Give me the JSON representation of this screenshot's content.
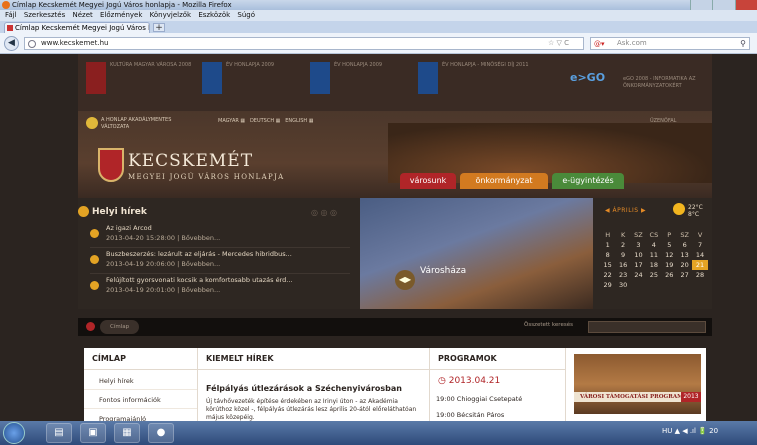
{
  "browser": {
    "window_title": "Címlap Kecskemét Megyei Jogú Város honlapja - Mozilla Firefox",
    "menu": [
      "Fájl",
      "Szerkesztés",
      "Nézet",
      "Előzmények",
      "Könyvjelzők",
      "Eszközök",
      "Súgó"
    ],
    "tab_title": "Címlap Kecskemét Megyei Jogú Város h...",
    "new_tab": "+",
    "url": "www.kecskemet.hu",
    "search_placeholder": "Ask.com",
    "back": "◀",
    "url_icons": "☆ ▽ C"
  },
  "site": {
    "top_strip": [
      "KULTÚRA MAGYAR VÁROSA 2008",
      "ÉV HONLAPJA 2009",
      "ÉV HONLAPJA 2009",
      "ÉV HONLAPJA - MINŐSÉGI DÍJ 2011",
      "eGO 2008 - INFORMATIKA AZ ÖNKORMÁNYZATOKÉRT"
    ],
    "ego_logo": "e>GO",
    "radio": "A HONLAP AKADÁLYMENTES VÁLTOZATA",
    "languages": [
      "MAGYAR",
      "DEUTSCH",
      "ENGLISH"
    ],
    "uzenetfal": "ÜZENŐFAL",
    "logo_title": "KECSKEMÉT",
    "logo_subtitle": "MEGYEI JOGÚ VÁROS HONLAPJA",
    "nav_tabs": [
      {
        "label": "városunk",
        "color": "#b02528"
      },
      {
        "label": "önkormányzat",
        "color": "#d27a20"
      },
      {
        "label": "e-ügyintézés",
        "color": "#4a8a3a"
      }
    ],
    "news_header": "Helyi hírek",
    "news": [
      {
        "title": "Az igazi Arcod",
        "meta": "2013-04-20 15:28:00 | Bővebben..."
      },
      {
        "title": "Buszbeszerzés: lezárult az eljárás - Mercedes hibridbus...",
        "meta": "2013-04-19 20:06:00 | Bővebben..."
      },
      {
        "title": "Felújított gyorsvonati kocsik a komfortosabb utazás érd...",
        "meta": "2013-04-19 20:01:00 | Bővebben..."
      }
    ],
    "slide_label": "Városháza",
    "calendar": {
      "month": "ÁPRILIS",
      "temp": "22°C",
      "temp2": "8°C",
      "days_header": [
        "H",
        "K",
        "SZ",
        "CS",
        "P",
        "SZ",
        "V"
      ],
      "rows": [
        [
          "1",
          "2",
          "3",
          "4",
          "5",
          "6",
          "7"
        ],
        [
          "8",
          "9",
          "10",
          "11",
          "12",
          "13",
          "14"
        ],
        [
          "15",
          "16",
          "17",
          "18",
          "19",
          "20",
          "21"
        ],
        [
          "22",
          "23",
          "24",
          "25",
          "26",
          "27",
          "28"
        ],
        [
          "29",
          "30",
          "",
          "",
          "",
          "",
          ""
        ]
      ],
      "current_day": "21"
    },
    "breadcrumb": "Címlap",
    "detailed_search": "Összetett keresés",
    "cimlap_header": "CÍMLAP",
    "cimlap_items": [
      "Helyi hírek",
      "Fontos információk",
      "Programajánló"
    ],
    "kiemelt_header": "KIEMELT HÍREK",
    "kiemelt_title": "Félpályás útlezárások a Széchenyivárosban",
    "kiemelt_text": "Új távhővezeték építése érdekében az Irinyi úton - az Akadémia körúthoz közel -, félpályás útlezárás lesz április 20-ától",
    "kiemelt_text2": "előreláthatóan május közepéig.",
    "programok_header": "PROGRAMOK",
    "program_date": "2013.04.21",
    "programs": [
      "19:00 Chioggiai Csetepaté",
      "19:00 Bécsitán Páros"
    ],
    "side_banner": "VÁROSI TÁMOGATÁSI PROGRAM",
    "side_year": "2013"
  },
  "taskbar": {
    "tray": "HU ▲ ◀ .ıl 🔋 20"
  }
}
